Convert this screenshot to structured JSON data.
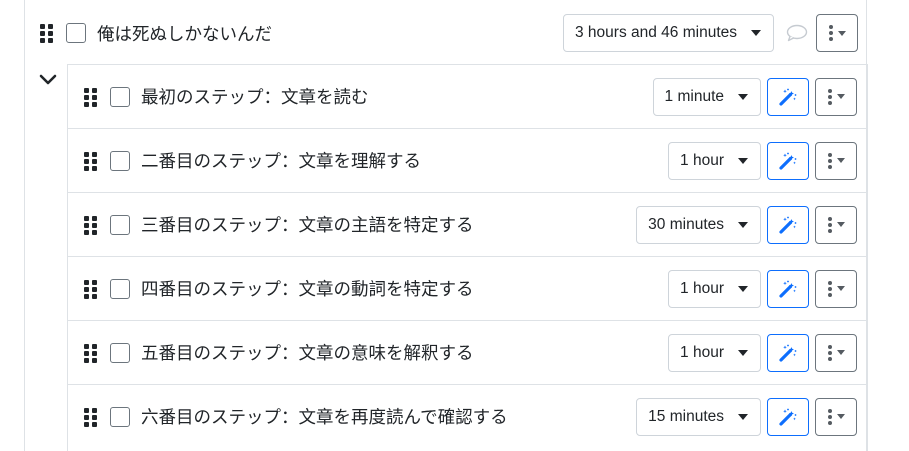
{
  "parent_task": {
    "title": "俺は死ぬしかないんだ",
    "duration": "3 hours and 46 minutes"
  },
  "subtasks": [
    {
      "title": "最初のステップ：文章を読む",
      "duration": "1 minute"
    },
    {
      "title": "二番目のステップ：文章を理解する",
      "duration": "1 hour"
    },
    {
      "title": "三番目のステップ：文章の主語を特定する",
      "duration": "30 minutes"
    },
    {
      "title": "四番目のステップ：文章の動詞を特定する",
      "duration": "1 hour"
    },
    {
      "title": "五番目のステップ：文章の意味を解釈する",
      "duration": "1 hour"
    },
    {
      "title": "六番目のステップ：文章を再度読んで確認する",
      "duration": "15 minutes"
    }
  ],
  "icons": {
    "drag_handle": "grip-icon",
    "expand": "chevron-down-icon",
    "comment": "comment-icon",
    "magic": "magic-wand-icon",
    "menu": "vertical-dots-icon"
  },
  "colors": {
    "accent": "#0d6efd",
    "border": "#dee2e6",
    "text": "#212529"
  }
}
